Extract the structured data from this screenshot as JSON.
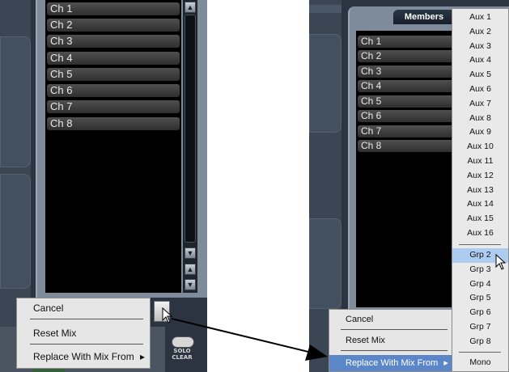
{
  "left_panel": {
    "channels": [
      "Ch 1",
      "Ch 2",
      "Ch 3",
      "Ch 4",
      "Ch 5",
      "Ch 6",
      "Ch 7",
      "Ch 8"
    ],
    "context_menu": {
      "items": [
        "Cancel",
        "Reset Mix",
        "Replace With Mix From"
      ],
      "submenu_arrow": "▸"
    },
    "solo_clear_label": "SOLO CLEAR"
  },
  "right_panel": {
    "tab_label": "Members",
    "channels": [
      "Ch 1",
      "Ch 2",
      "Ch 3",
      "Ch 4",
      "Ch 5",
      "Ch 6",
      "Ch 7",
      "Ch 8"
    ],
    "context_menu": {
      "items": [
        "Cancel",
        "Reset Mix",
        "Replace With Mix From"
      ],
      "submenu_arrow": "▸"
    },
    "submenu": {
      "aux_items": [
        "Aux 1",
        "Aux 2",
        "Aux 3",
        "Aux 4",
        "Aux 5",
        "Aux 6",
        "Aux 7",
        "Aux 8",
        "Aux 9",
        "Aux 10",
        "Aux 11",
        "Aux 12",
        "Aux 13",
        "Aux 14",
        "Aux 15",
        "Aux 16"
      ],
      "grp_items": [
        "Grp 2",
        "Grp 3",
        "Grp 4",
        "Grp 5",
        "Grp 6",
        "Grp 7",
        "Grp 8"
      ],
      "mono_label": "Mono",
      "highlighted": "Grp 2"
    }
  },
  "colors": {
    "panel_bg": "#2b3440",
    "menu_highlight": "#5b87c9",
    "submenu_highlight": "#aecbf0"
  }
}
